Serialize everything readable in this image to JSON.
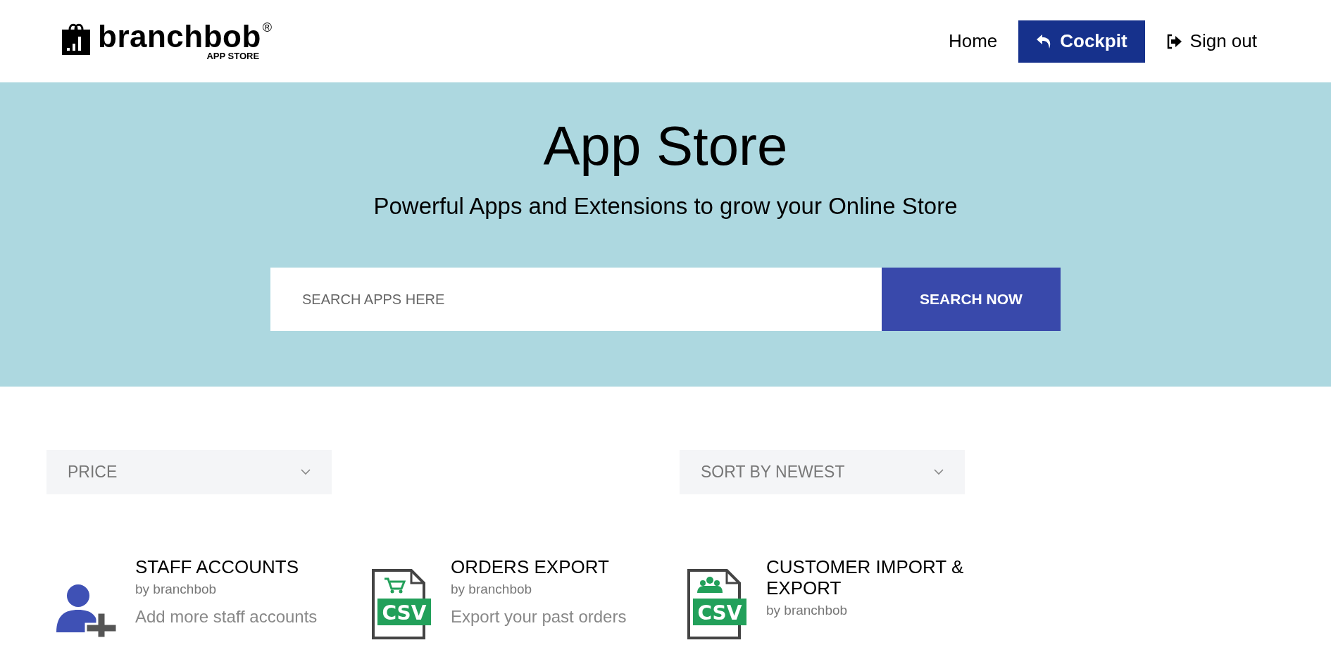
{
  "header": {
    "logo": {
      "name": "branchbob",
      "mark": "®",
      "tagline": "APP STORE"
    },
    "nav": [
      {
        "label": "Home",
        "kind": "plain"
      },
      {
        "label": "Cockpit",
        "kind": "primary"
      },
      {
        "label": "Sign out",
        "kind": "signout"
      }
    ]
  },
  "hero": {
    "title": "App Store",
    "subtitle": "Powerful Apps and Extensions to grow your Online Store",
    "search": {
      "placeholder": "SEARCH APPS HERE",
      "button": "SEARCH NOW"
    }
  },
  "filters": [
    {
      "label": "PRICE"
    },
    {
      "label": "SORT BY NEWEST"
    }
  ],
  "apps": [
    {
      "title": "STAFF ACCOUNTS",
      "author": "by branchbob",
      "description": "Add more staff accounts",
      "icon": {
        "kind": "person-add"
      }
    },
    {
      "title": "ORDERS EXPORT",
      "author": "by branchbob",
      "description": "Export your past orders",
      "icon": {
        "kind": "csv-cart",
        "badge": "CSV"
      }
    },
    {
      "title": "CUSTOMER IMPORT & EXPORT",
      "author": "by branchbob",
      "icon": {
        "kind": "csv-people",
        "badge": "CSV"
      }
    }
  ]
}
